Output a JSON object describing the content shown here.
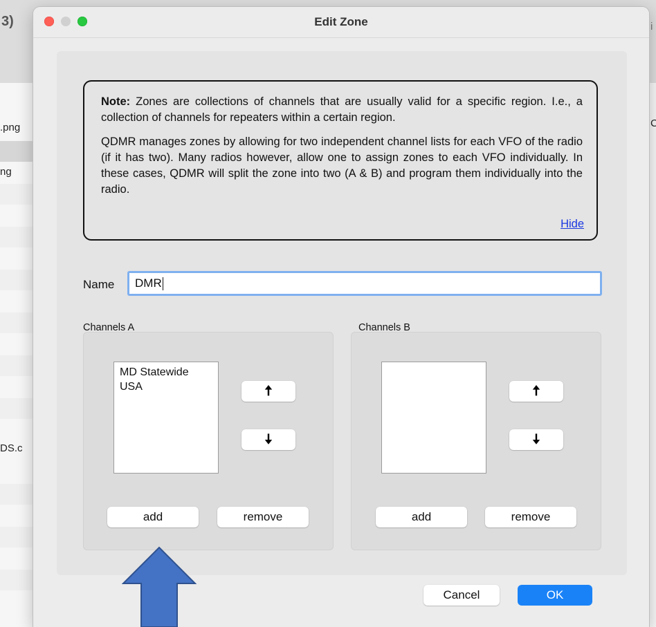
{
  "background": {
    "partial_labels": [
      "3)",
      ".png",
      "ng",
      "DS.c",
      "C",
      "i"
    ]
  },
  "dialog": {
    "title": "Edit Zone",
    "note": {
      "bold_prefix": "Note:",
      "paragraph1": "Zones are collections of channels that are usually valid for a specific region. I.e., a collection of channels for repeaters within a certain region.",
      "paragraph2": "QDMR manages zones by allowing for two independent channel lists for each VFO of the radio (if it has two). Many radios however, allow one to assign zones to each VFO individually. In these cases, QDMR will split the zone into two (A & B) and program them individually into the radio.",
      "hide_link": "Hide"
    },
    "name": {
      "label": "Name",
      "value": "DMR"
    },
    "channels_a": {
      "label": "Channels A",
      "items": [
        "MD Statewide",
        "USA"
      ],
      "up_icon": "🠅",
      "down_icon": "🠇",
      "add_label": "add",
      "remove_label": "remove"
    },
    "channels_b": {
      "label": "Channels B",
      "items": [],
      "up_icon": "🠅",
      "down_icon": "🠇",
      "add_label": "add",
      "remove_label": "remove"
    },
    "footer": {
      "cancel_label": "Cancel",
      "ok_label": "OK"
    }
  },
  "annotation": {
    "arrow_color": "#4472c4"
  }
}
